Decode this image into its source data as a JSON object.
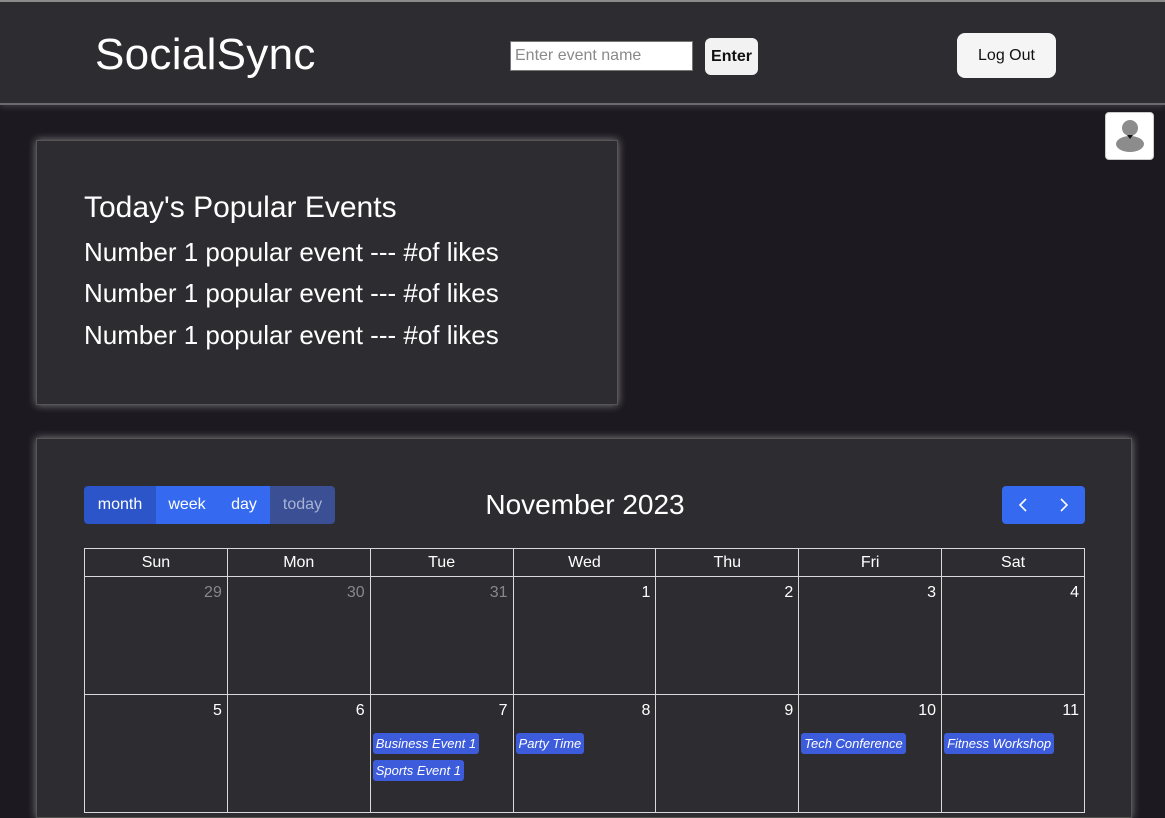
{
  "header": {
    "app_name": "SocialSync",
    "search_placeholder": "Enter event name",
    "search_value": "",
    "enter_label": "Enter",
    "logout_label": "Log Out"
  },
  "popular": {
    "title": "Today's Popular Events",
    "items": [
      "Number 1 popular event --- #of likes",
      "Number 1 popular event --- #of likes",
      "Number 1 popular event --- #of likes"
    ]
  },
  "calendar": {
    "views": [
      "month",
      "week",
      "day"
    ],
    "today_label": "today",
    "title": "November 2023",
    "weekdays": [
      "Sun",
      "Mon",
      "Tue",
      "Wed",
      "Thu",
      "Fri",
      "Sat"
    ],
    "weeks": [
      [
        {
          "day": "29",
          "other": true,
          "events": []
        },
        {
          "day": "30",
          "other": true,
          "events": []
        },
        {
          "day": "31",
          "other": true,
          "events": []
        },
        {
          "day": "1",
          "other": false,
          "events": []
        },
        {
          "day": "2",
          "other": false,
          "events": []
        },
        {
          "day": "3",
          "other": false,
          "events": []
        },
        {
          "day": "4",
          "other": false,
          "events": []
        }
      ],
      [
        {
          "day": "5",
          "other": false,
          "events": []
        },
        {
          "day": "6",
          "other": false,
          "events": []
        },
        {
          "day": "7",
          "other": false,
          "events": [
            "Business Event 1",
            "Sports Event 1"
          ]
        },
        {
          "day": "8",
          "other": false,
          "events": [
            "Party Time"
          ]
        },
        {
          "day": "9",
          "other": false,
          "events": []
        },
        {
          "day": "10",
          "other": false,
          "events": [
            "Tech Conference"
          ]
        },
        {
          "day": "11",
          "other": false,
          "events": [
            "Fitness Workshop"
          ]
        }
      ]
    ]
  },
  "colors": {
    "accent": "#3469f0",
    "event": "#3d5cdb",
    "panel": "#2d2c31",
    "background": "#1c1a20"
  }
}
